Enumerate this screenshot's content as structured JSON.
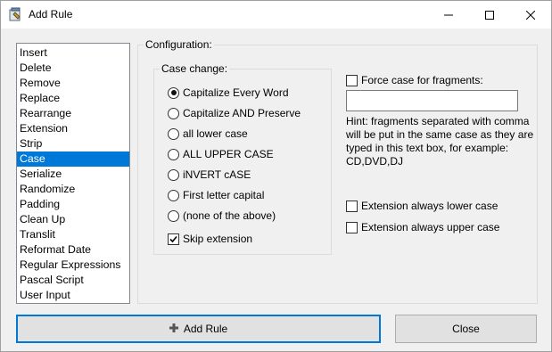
{
  "window": {
    "title": "Add Rule"
  },
  "rules": {
    "items": [
      "Insert",
      "Delete",
      "Remove",
      "Replace",
      "Rearrange",
      "Extension",
      "Strip",
      "Case",
      "Serialize",
      "Randomize",
      "Padding",
      "Clean Up",
      "Translit",
      "Reformat Date",
      "Regular Expressions",
      "Pascal Script",
      "User Input"
    ],
    "selected": "Case"
  },
  "config": {
    "label": "Configuration:",
    "case_group_label": "Case change:",
    "options": [
      {
        "label": "Capitalize Every Word",
        "checked": true
      },
      {
        "label": "Capitalize AND Preserve",
        "checked": false
      },
      {
        "label": "all lower case",
        "checked": false
      },
      {
        "label": "ALL UPPER CASE",
        "checked": false
      },
      {
        "label": "iNVERT cASE",
        "checked": false
      },
      {
        "label": "First letter capital",
        "checked": false
      },
      {
        "label": "(none of the above)",
        "checked": false
      }
    ],
    "skip_extension": {
      "label": "Skip extension",
      "checked": true
    },
    "force_case": {
      "label": "Force case for fragments:",
      "checked": false,
      "value": ""
    },
    "hint": "Hint: fragments separated with comma will be put in the same case as they are typed in this text box, for example: CD,DVD,DJ",
    "ext_lower": {
      "label": "Extension always lower case",
      "checked": false
    },
    "ext_upper": {
      "label": "Extension always upper case",
      "checked": false
    }
  },
  "buttons": {
    "add_rule": "Add Rule",
    "close": "Close"
  },
  "colors": {
    "selection": "#0078d7",
    "accent_border": "#0078d7",
    "plus_icon": "#555555"
  }
}
